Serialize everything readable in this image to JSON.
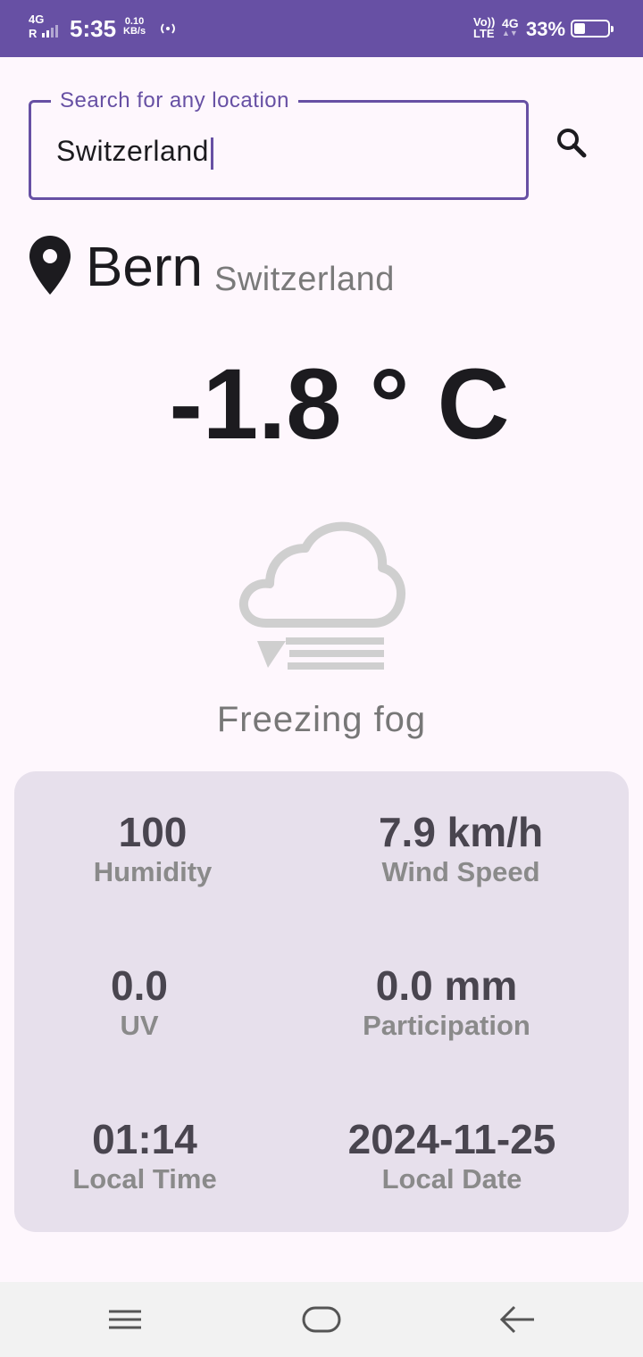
{
  "status_bar": {
    "network": "4G",
    "signal": "R",
    "time": "5:35",
    "speed_value": "0.10",
    "speed_unit": "KB/s",
    "volte_top": "Vo))",
    "volte_bottom": "LTE",
    "network_type": "4G",
    "battery_percent": "33%",
    "battery_level": 0.33,
    "hotspot_icon": "hotspot-icon"
  },
  "search": {
    "label": "Search for any location",
    "value": "Switzerland",
    "icon": "search-icon"
  },
  "location": {
    "city": "Bern",
    "country": "Switzerland",
    "icon": "location-pin-icon"
  },
  "temperature": "-1.8 ° C",
  "condition": {
    "text": "Freezing fog",
    "icon": "freezing-fog-icon"
  },
  "stats": {
    "humidity": {
      "value": "100",
      "label": "Humidity"
    },
    "wind_speed": {
      "value": "7.9 km/h",
      "label": "Wind Speed"
    },
    "uv": {
      "value": "0.0",
      "label": "UV"
    },
    "precipitation": {
      "value": "0.0 mm",
      "label": "Participation"
    },
    "local_time": {
      "value": "01:14",
      "label": "Local Time"
    },
    "local_date": {
      "value": "2024-11-25",
      "label": "Local Date"
    }
  },
  "nav_bar": {
    "menu_icon": "menu-icon",
    "home_icon": "home-icon",
    "back_icon": "back-icon"
  },
  "colors": {
    "primary": "#6750a4",
    "background": "#fef7fd",
    "card": "#e7e0ec"
  }
}
